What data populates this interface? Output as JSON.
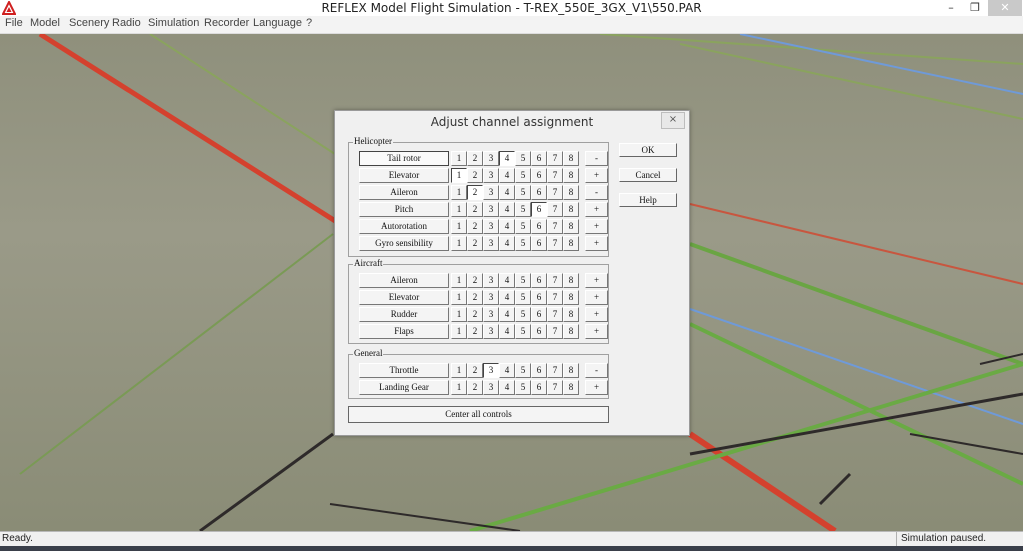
{
  "window": {
    "title": "REFLEX Model Flight Simulation - T-REX_550E_3GX_V1\\550.PAR",
    "minimize": "–",
    "maximize": "❐",
    "close": "✕"
  },
  "menu": [
    "File",
    "Model",
    "Scenery",
    "Radio",
    "Simulation",
    "Recorder",
    "Language",
    "?"
  ],
  "status": {
    "left": "Ready.",
    "right": "Simulation paused."
  },
  "dialog": {
    "title": "Adjust channel assignment",
    "close": "×",
    "buttons": {
      "ok": "OK",
      "cancel": "Cancel",
      "help": "Help"
    },
    "center_all": "Center all controls",
    "groups": [
      {
        "label": "Helicopter",
        "rows": [
          {
            "name": "Tail rotor",
            "selected": 4,
            "sign": "-"
          },
          {
            "name": "Elevator",
            "selected": 1,
            "sign": "+"
          },
          {
            "name": "Aileron",
            "selected": 2,
            "sign": "-"
          },
          {
            "name": "Pitch",
            "selected": 6,
            "sign": "+"
          },
          {
            "name": "Autorotation",
            "selected": 0,
            "sign": "+"
          },
          {
            "name": "Gyro sensibility",
            "selected": 0,
            "sign": "+"
          }
        ]
      },
      {
        "label": "Aircraft",
        "rows": [
          {
            "name": "Aileron",
            "selected": 0,
            "sign": "+"
          },
          {
            "name": "Elevator",
            "selected": 0,
            "sign": "+"
          },
          {
            "name": "Rudder",
            "selected": 0,
            "sign": "+"
          },
          {
            "name": "Flaps",
            "selected": 0,
            "sign": "+"
          }
        ]
      },
      {
        "label": "General",
        "rows": [
          {
            "name": "Throttle",
            "selected": 3,
            "sign": "-"
          },
          {
            "name": "Landing Gear",
            "selected": 0,
            "sign": "+"
          }
        ]
      }
    ],
    "channels": [
      "1",
      "2",
      "3",
      "4",
      "5",
      "6",
      "7",
      "8"
    ]
  }
}
